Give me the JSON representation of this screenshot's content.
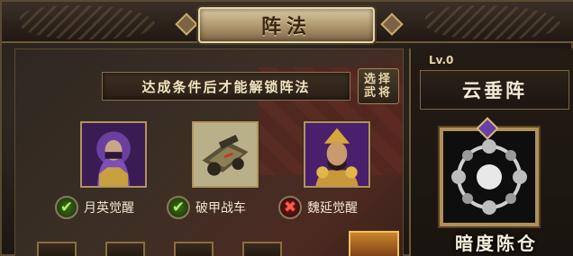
{
  "header": {
    "title": "阵法"
  },
  "condition": {
    "text": "达成条件后才能解锁阵法"
  },
  "select_button": {
    "line1": "选择",
    "line2": "武将"
  },
  "heroes": [
    {
      "name": "月英觉醒",
      "status": "done"
    },
    {
      "name": "破甲战车",
      "status": "done"
    },
    {
      "name": "魏延觉醒",
      "status": "missing"
    }
  ],
  "side": {
    "level": "Lv.0",
    "formation_name": "云垂阵",
    "featured_name": "暗度陈仓"
  },
  "colors": {
    "accent_gold": "#b09460",
    "ok_green": "#b6f05a",
    "fail_red": "#ff5a4a"
  }
}
